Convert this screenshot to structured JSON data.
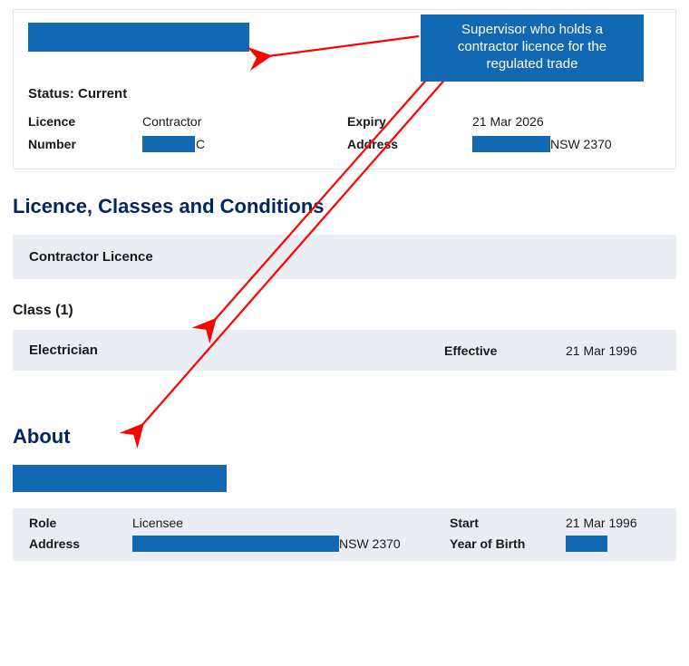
{
  "callout": {
    "text": "Supervisor who holds a contractor licence for the regulated trade"
  },
  "card": {
    "status_label": "Status:",
    "status_value": "Current",
    "licence_label": "Licence",
    "licence_value": "Contractor",
    "number_label": "Number",
    "number_suffix": "C",
    "expiry_label": "Expiry",
    "expiry_value": "21 Mar 2026",
    "address_label": "Address",
    "address_suffix": "NSW 2370"
  },
  "section1": {
    "heading": "Licence, Classes and Conditions",
    "band_label": "Contractor Licence",
    "class_heading": "Class (1)",
    "class_value": "Electrician",
    "effective_label": "Effective",
    "effective_value": "21 Mar 1996"
  },
  "about": {
    "heading": "About",
    "role_label": "Role",
    "role_value": "Licensee",
    "address_label": "Address",
    "address_suffix": "NSW 2370",
    "start_label": "Start",
    "start_value": "21 Mar 1996",
    "yob_label": "Year of Birth"
  }
}
